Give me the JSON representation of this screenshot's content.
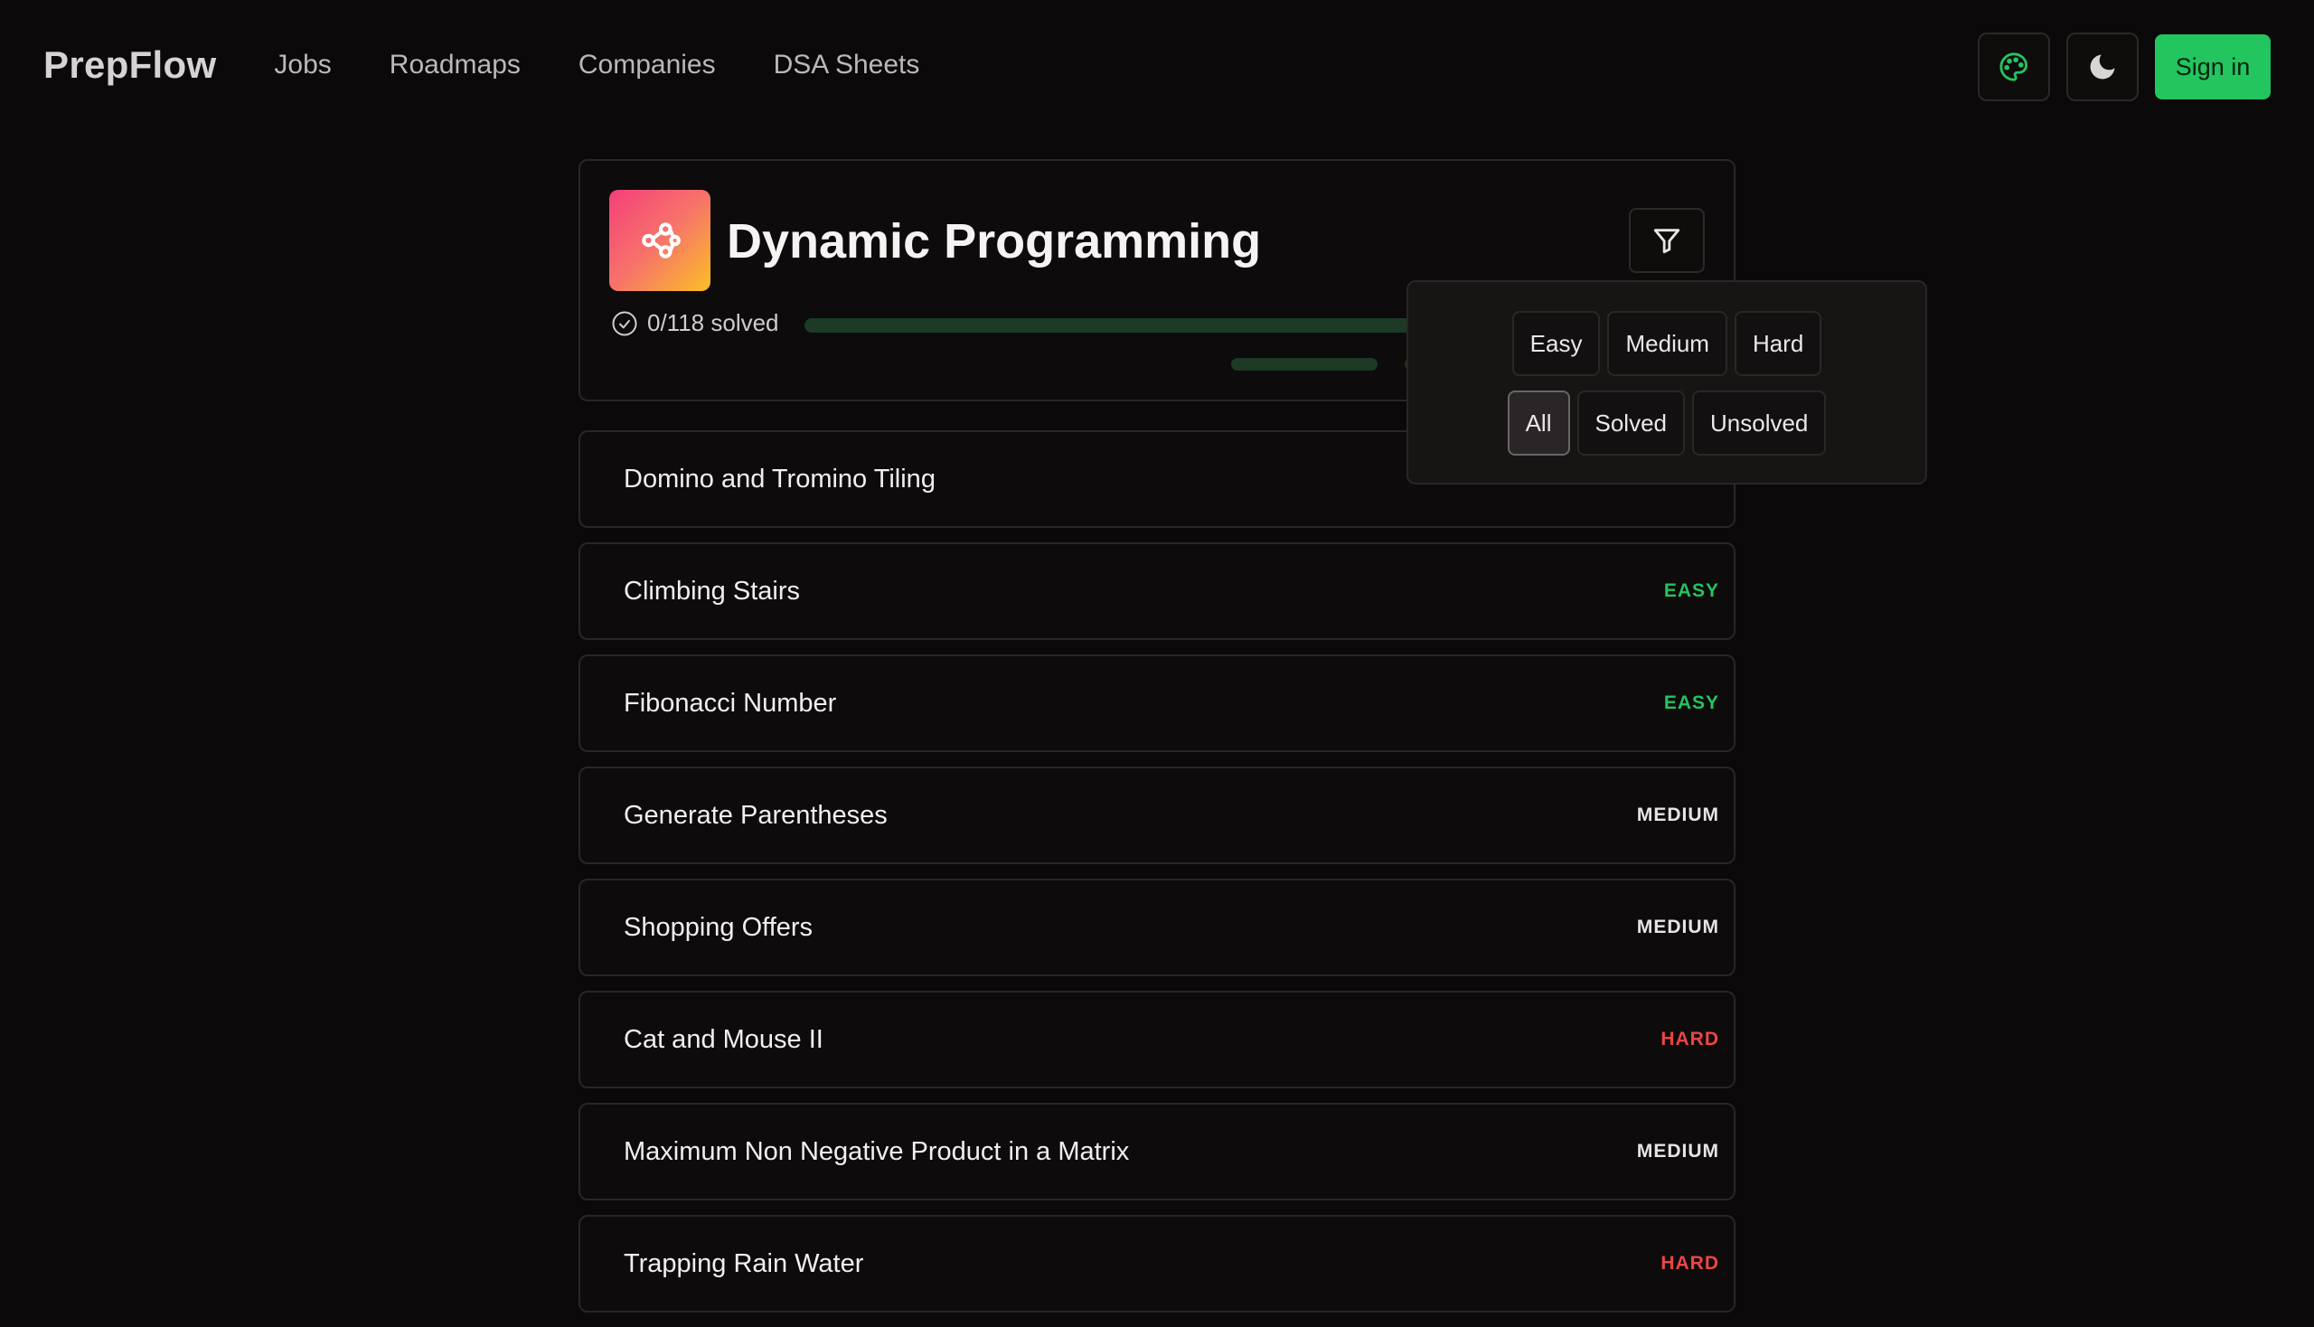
{
  "nav": {
    "brand": "PrepFlow",
    "links": [
      "Jobs",
      "Roadmaps",
      "Companies",
      "DSA Sheets"
    ],
    "signin_label": "Sign in",
    "accent": "#22c55e"
  },
  "topic": {
    "title": "Dynamic Programming",
    "solved_text": "0/118 solved",
    "solved_count": 0,
    "total_count": 118
  },
  "filter": {
    "difficulty_options": [
      "Easy",
      "Medium",
      "Hard"
    ],
    "status_options": [
      "All",
      "Solved",
      "Unsolved"
    ],
    "active_status": "All"
  },
  "problems": [
    {
      "title": "Domino and Tromino Tiling",
      "difficulty": ""
    },
    {
      "title": "Climbing Stairs",
      "difficulty": "EASY"
    },
    {
      "title": "Fibonacci Number",
      "difficulty": "EASY"
    },
    {
      "title": "Generate Parentheses",
      "difficulty": "MEDIUM"
    },
    {
      "title": "Shopping Offers",
      "difficulty": "MEDIUM"
    },
    {
      "title": "Cat and Mouse II",
      "difficulty": "HARD"
    },
    {
      "title": "Maximum Non Negative Product in a Matrix",
      "difficulty": "MEDIUM"
    },
    {
      "title": "Trapping Rain Water",
      "difficulty": "HARD"
    }
  ],
  "colors": {
    "easy": "#22c55e",
    "medium": "#e8e4e4",
    "hard": "#ef4444"
  }
}
